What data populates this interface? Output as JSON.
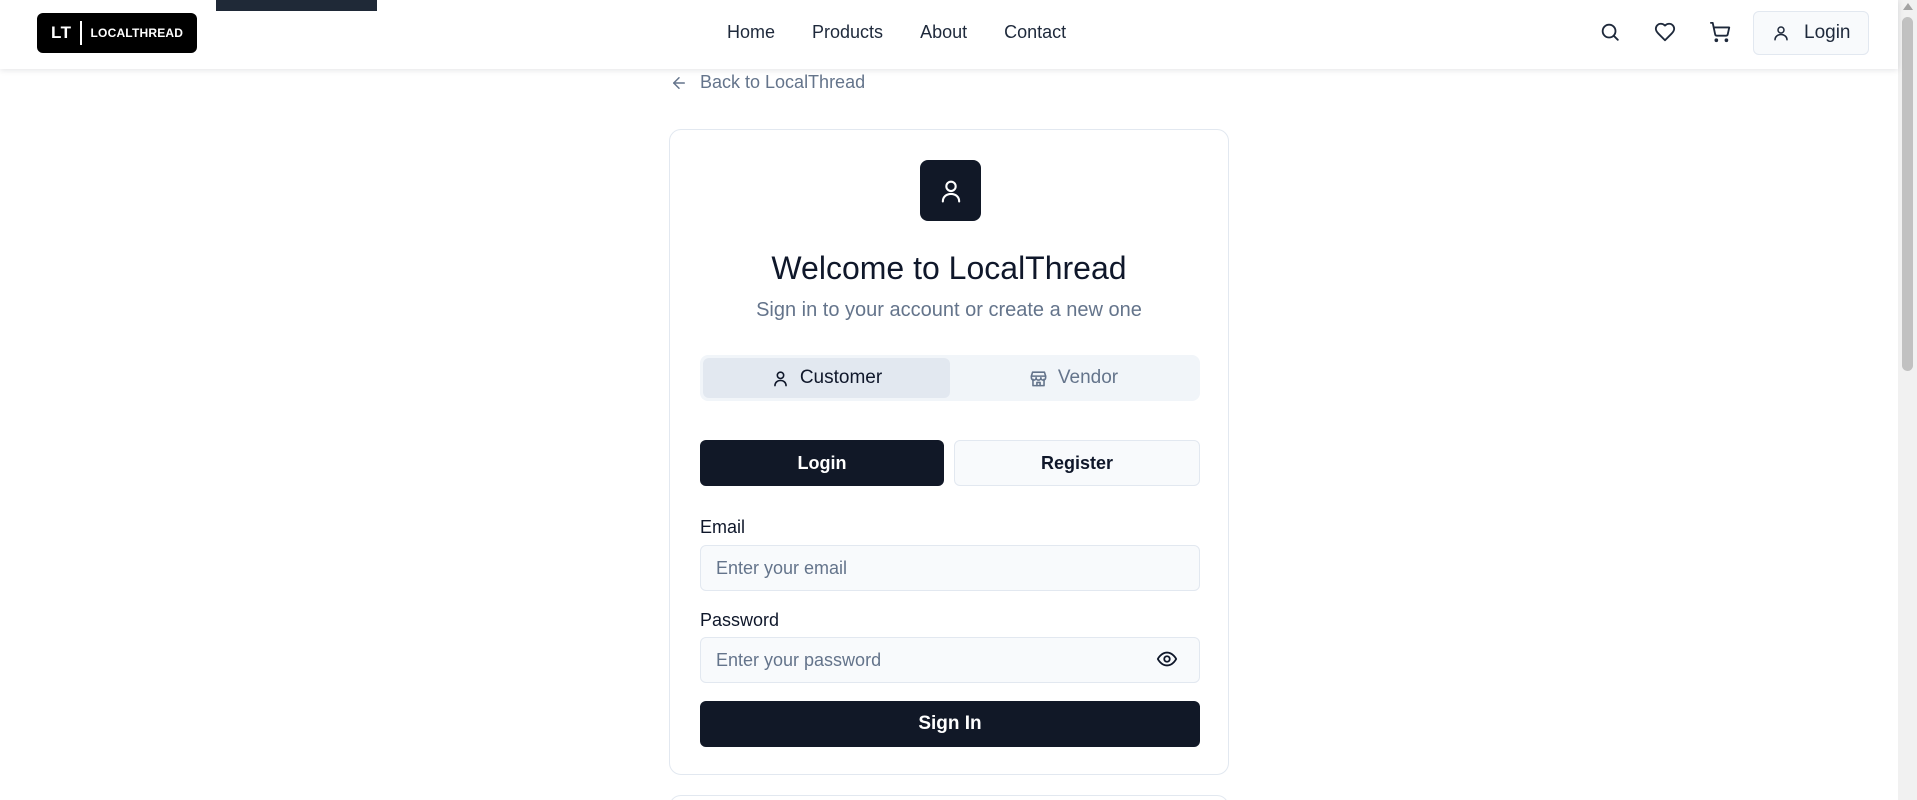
{
  "header": {
    "logo_mark": "LT",
    "logo_name": "LOCALTHREAD",
    "nav": [
      "Home",
      "Products",
      "About",
      "Contact"
    ],
    "icons": [
      "search-icon",
      "heart-icon",
      "cart-icon"
    ],
    "login_label": "Login"
  },
  "back_link": "Back to LocalThread",
  "auth_card": {
    "title": "Welcome to LocalThread",
    "subtitle": "Sign in to your account or create a new one",
    "roles": [
      {
        "label": "Customer",
        "icon": "user-icon",
        "active": true
      },
      {
        "label": "Vendor",
        "icon": "store-icon",
        "active": false
      }
    ],
    "modes": {
      "login": "Login",
      "register": "Register"
    },
    "email_label": "Email",
    "email_placeholder": "Enter your email",
    "password_label": "Password",
    "password_placeholder": "Enter your password",
    "submit_label": "Sign In"
  },
  "colors": {
    "primary": "#111827",
    "muted_text": "#64748b",
    "border": "#e2e8f0",
    "input_bg": "#f8fafc"
  }
}
